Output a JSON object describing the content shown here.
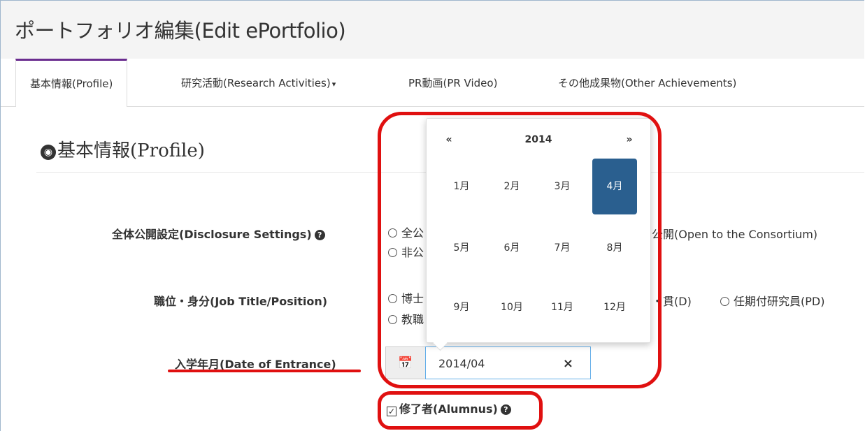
{
  "header": {
    "title": "ポートフォリオ編集(Edit ePortfolio)"
  },
  "tabs": [
    {
      "label": "基本情報(Profile)"
    },
    {
      "label": "研究活動(Research Activities)"
    },
    {
      "label": "PR動画(PR Video)"
    },
    {
      "label": "その他成果物(Other Achievements)"
    }
  ],
  "tab_caret": "▾",
  "section": {
    "title": "基本情報(Profile)",
    "icon": "globe-icon"
  },
  "form": {
    "disclosure": {
      "label": "全体公開設定(Disclosure Settings)",
      "options": [
        "全公",
        "非公"
      ],
      "trailing_option": "公開(Open to the Consortium)"
    },
    "position": {
      "label": "職位・身分(Job Title/Position)",
      "options": [
        "博士",
        "教職"
      ],
      "trailing_text": "・貫(D)",
      "trailing_option": "任期付研究員(PD)"
    },
    "entrance": {
      "label": "入学年月(Date of Entrance)",
      "value": "2014/04",
      "clear": "×",
      "calendar_icon": "calendar-icon"
    },
    "alumnus": {
      "label": "修了者(Alumnus)",
      "checked": true
    }
  },
  "datepicker": {
    "prev": "«",
    "year": "2014",
    "next": "»",
    "months": [
      "1月",
      "2月",
      "3月",
      "4月",
      "5月",
      "6月",
      "7月",
      "8月",
      "9月",
      "10月",
      "11月",
      "12月"
    ],
    "selected_month": "4月"
  },
  "colors": {
    "accent_tab": "#6a2c8f",
    "selected_month": "#2a5f8f",
    "annotation_red": "#e01010"
  }
}
